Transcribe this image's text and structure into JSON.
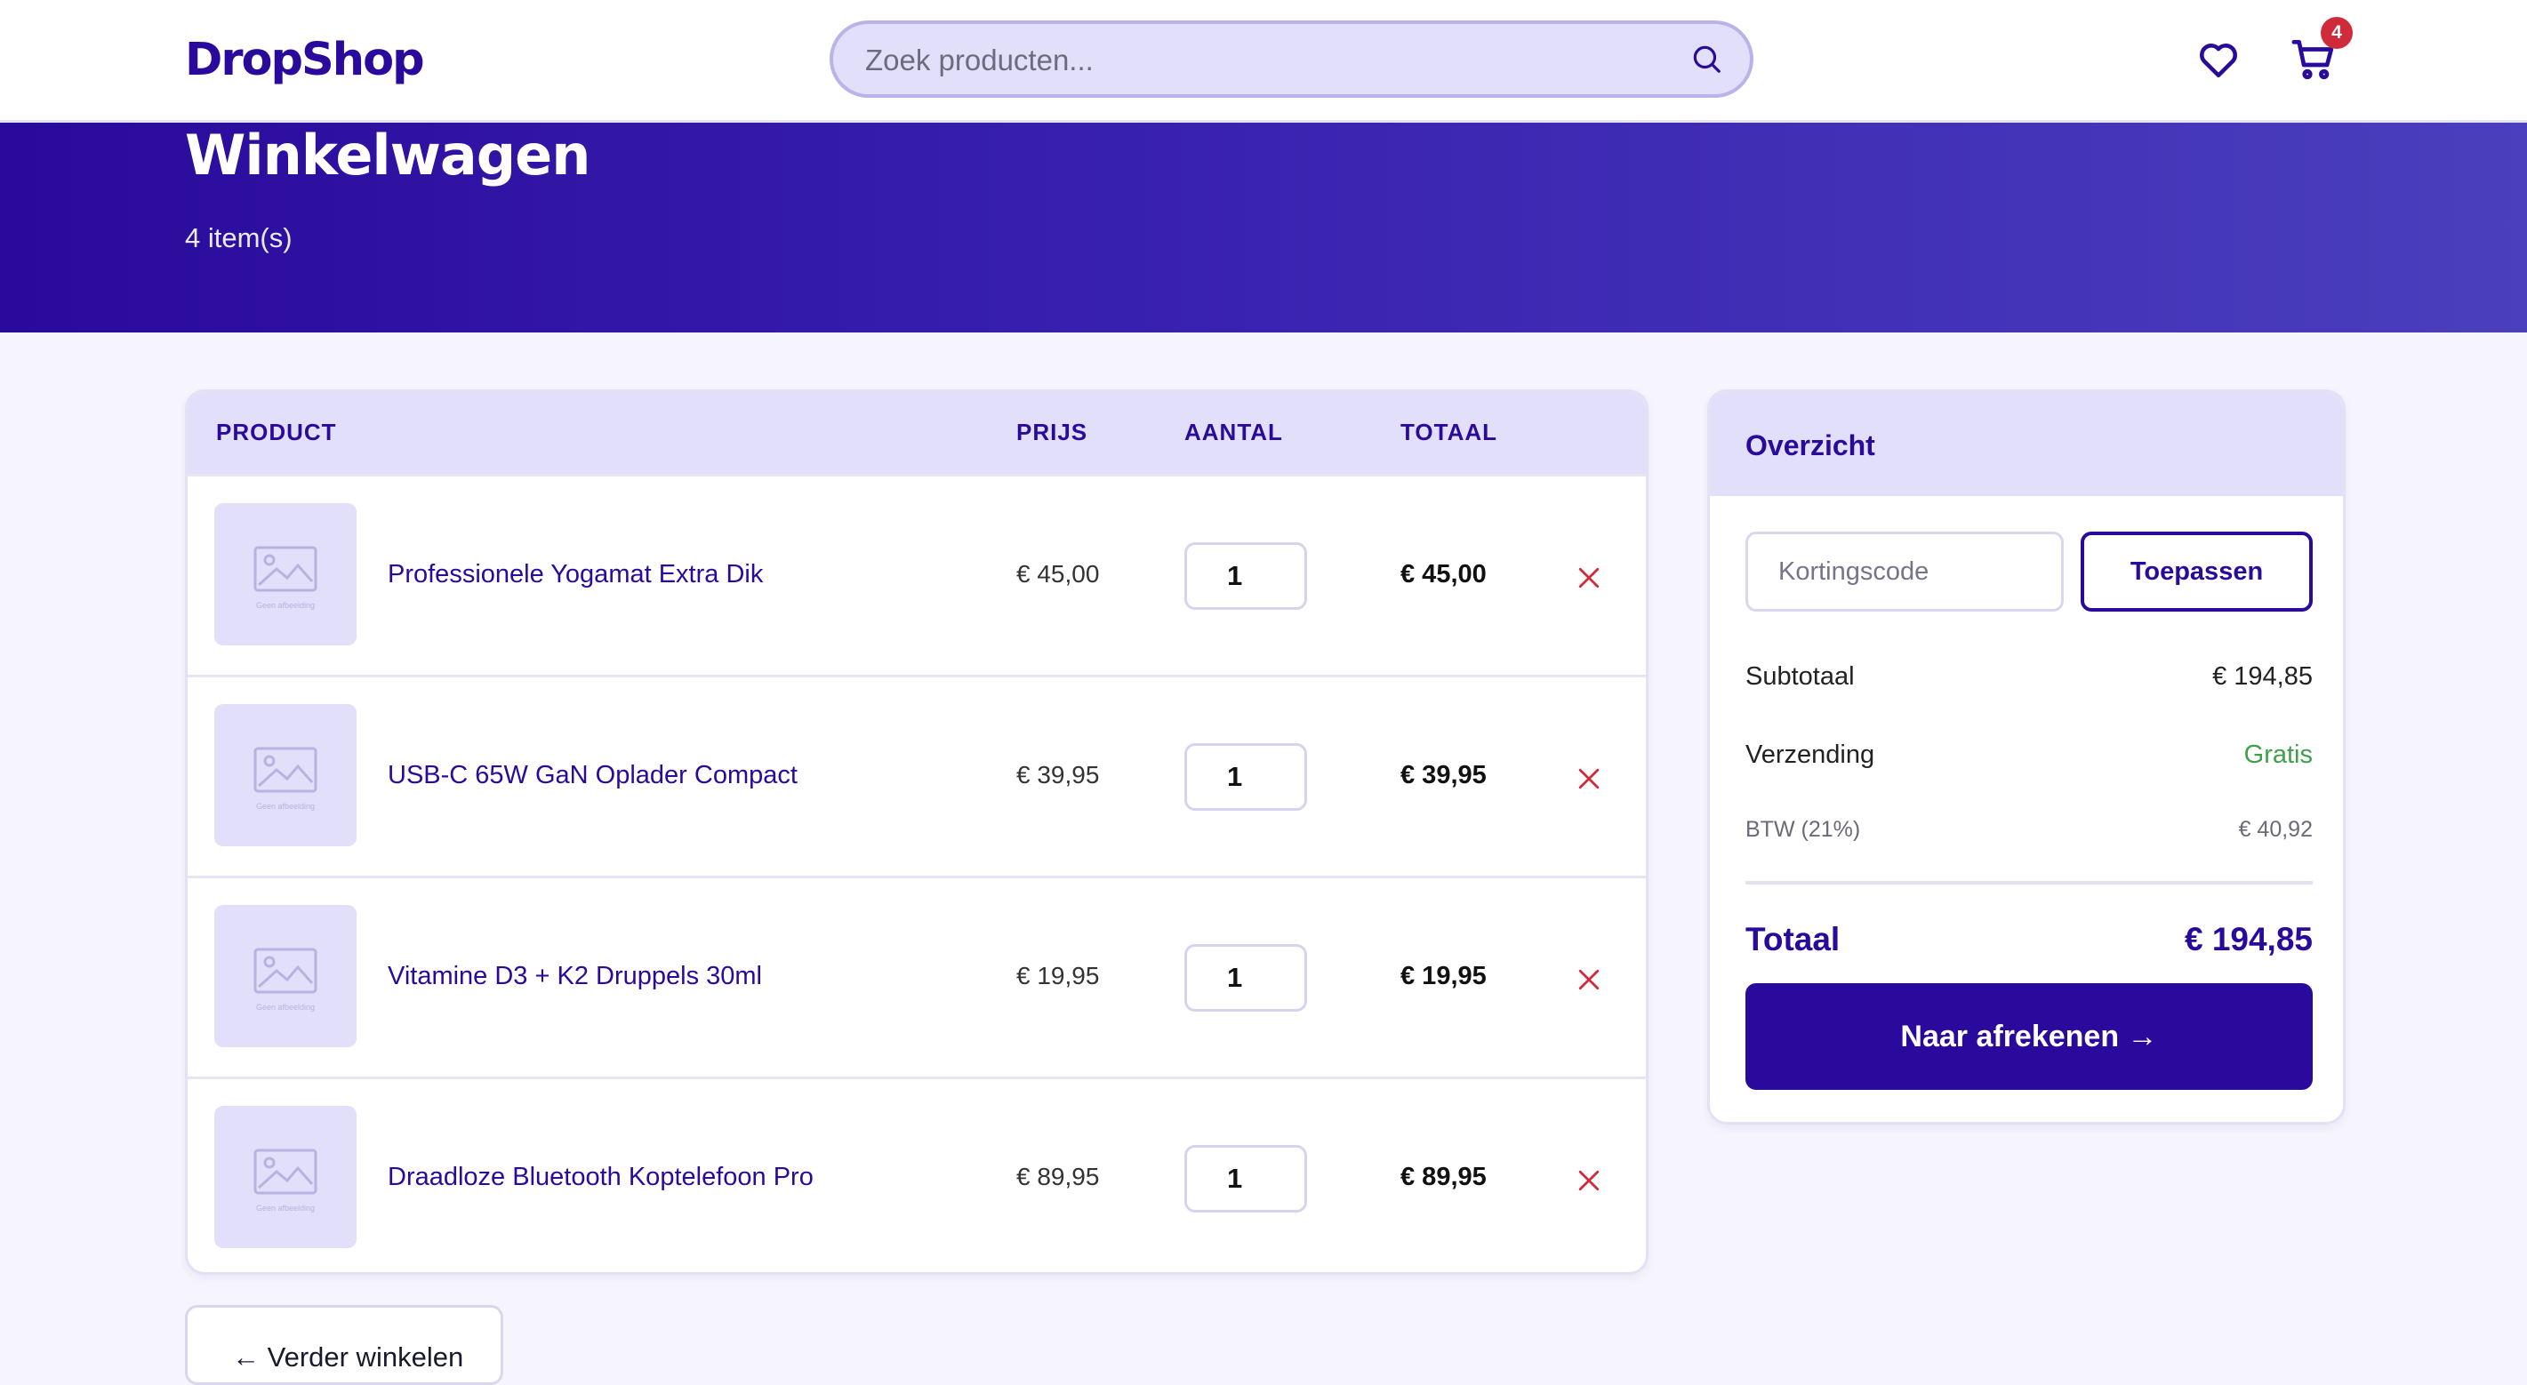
{
  "header": {
    "logo": "DropShop",
    "search_placeholder": "Zoek producten...",
    "cart_count": "4"
  },
  "hero": {
    "title": "Winkelwagen",
    "item_count": "4 item(s)"
  },
  "table": {
    "columns": [
      "PRODUCT",
      "PRIJS",
      "AANTAL",
      "TOTAAL"
    ],
    "image_placeholder": "Geen afbeelding",
    "rows": [
      {
        "name": "Professionele Yogamat Extra Dik",
        "price": "€ 45,00",
        "qty": "1",
        "total": "€ 45,00"
      },
      {
        "name": "USB-C 65W GaN Oplader Compact",
        "price": "€ 39,95",
        "qty": "1",
        "total": "€ 39,95"
      },
      {
        "name": "Vitamine D3 + K2 Druppels 30ml",
        "price": "€ 19,95",
        "qty": "1",
        "total": "€ 19,95"
      },
      {
        "name": "Draadloze Bluetooth Koptelefoon Pro",
        "price": "€ 89,95",
        "qty": "1",
        "total": "€ 89,95"
      }
    ]
  },
  "continue_label": "← Verder winkelen",
  "summary": {
    "title": "Overzicht",
    "coupon_placeholder": "Kortingscode",
    "apply_label": "Toepassen",
    "subtotal_label": "Subtotaal",
    "subtotal_value": "€ 194,85",
    "shipping_label": "Verzending",
    "shipping_value": "Gratis",
    "vat_label": "BTW (21%)",
    "vat_value": "€ 40,92",
    "total_label": "Totaal",
    "total_value": "€ 194,85",
    "checkout_label": "Naar afrekenen →"
  },
  "colors": {
    "brand": "#2a0a9c",
    "accent_light": "#e1dffa",
    "remove": "#cf2b3b",
    "free_shipping": "#3fa04b"
  }
}
